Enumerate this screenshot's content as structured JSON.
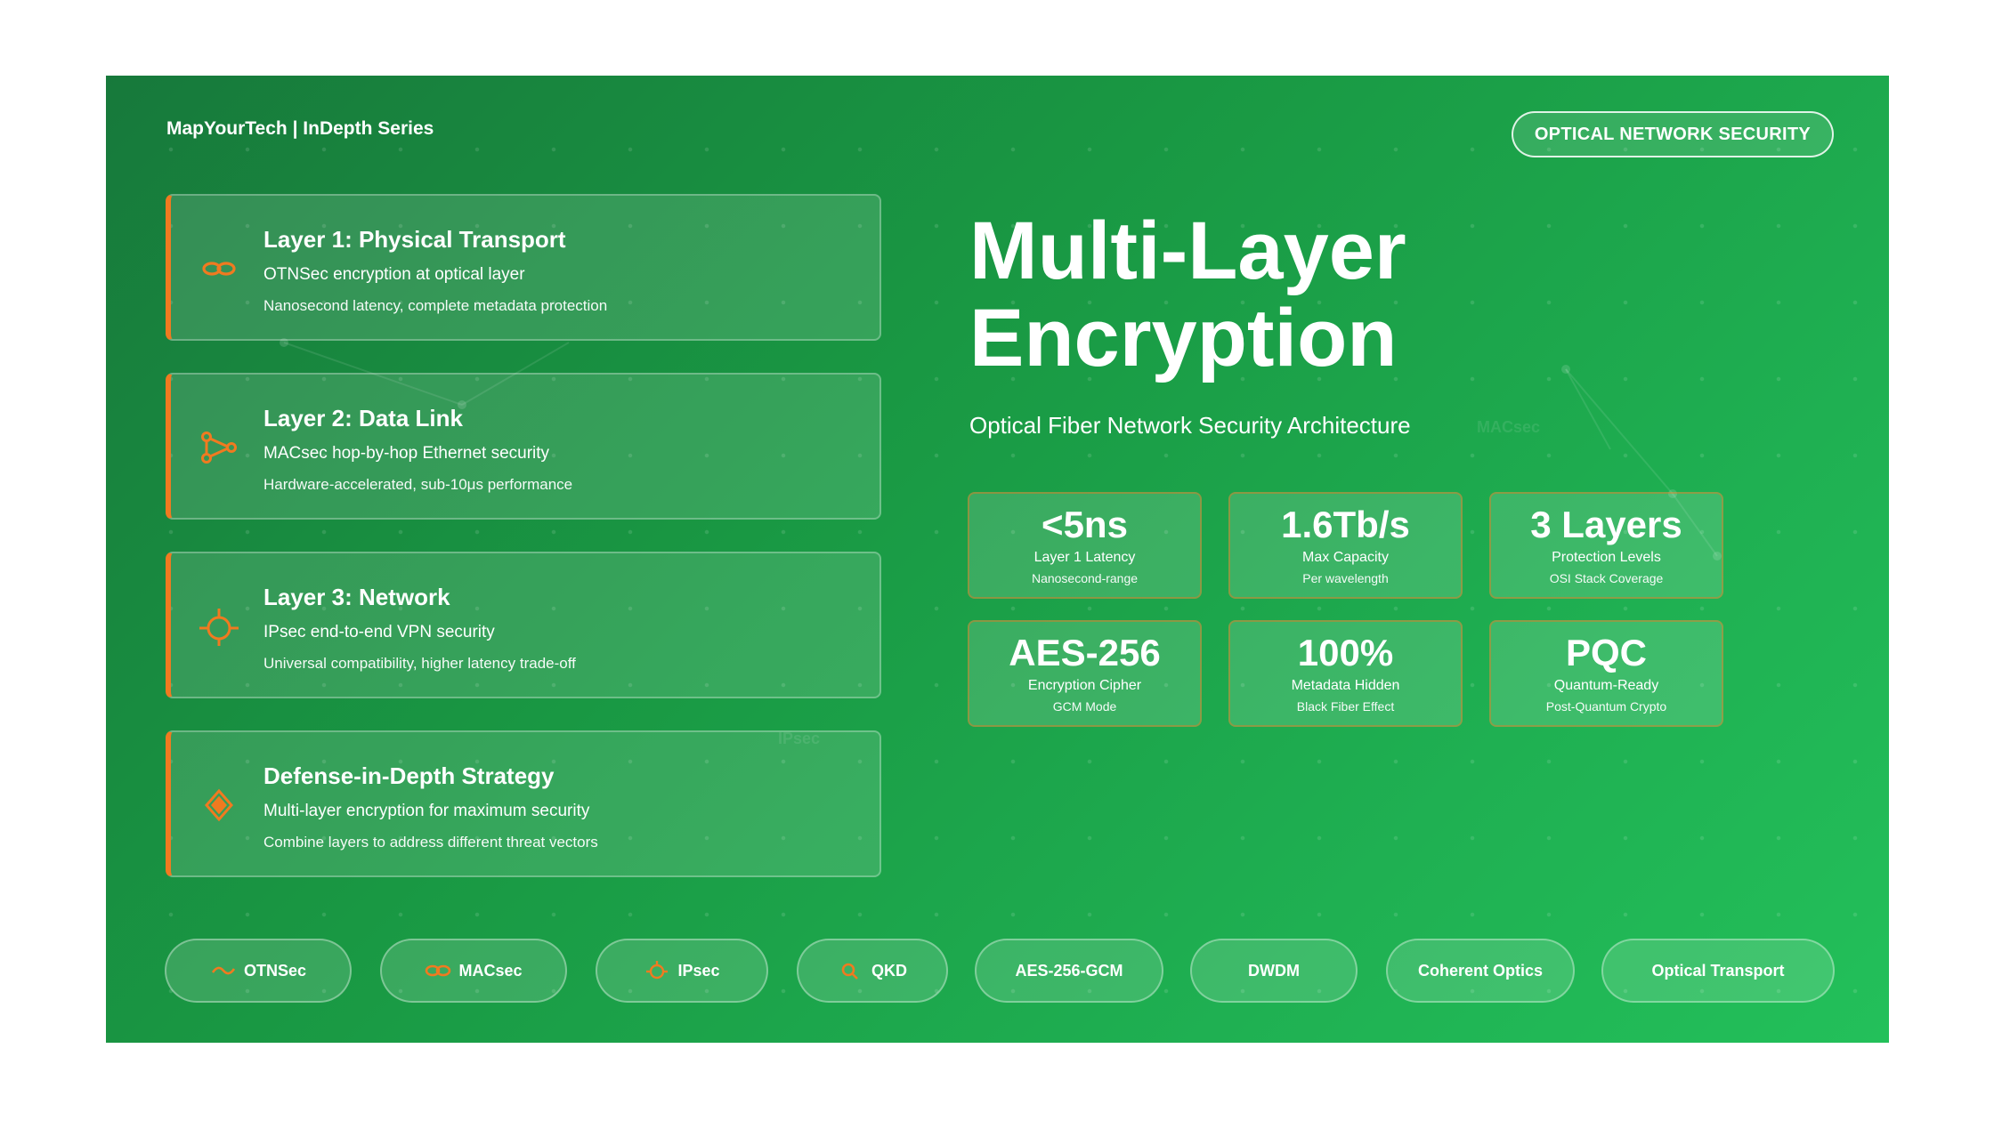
{
  "brand": "MapYourTech | InDepth Series",
  "badge": "OPTICAL NETWORK SECURITY",
  "hero": {
    "title_line1": "Multi-Layer",
    "title_line2": "Encryption",
    "subtitle": "Optical Fiber Network Security Architecture"
  },
  "layers": [
    {
      "title": "Layer 1: Physical Transport",
      "desc": "OTNSec encryption at optical layer",
      "detail": "Nanosecond latency, complete metadata protection",
      "icon": "infinity-link-icon"
    },
    {
      "title": "Layer 2: Data Link",
      "desc": "MACsec hop-by-hop Ethernet security",
      "detail": "Hardware-accelerated, sub-10μs performance",
      "icon": "share-nodes-icon"
    },
    {
      "title": "Layer 3: Network",
      "desc": "IPsec end-to-end VPN security",
      "detail": "Universal compatibility, higher latency trade-off",
      "icon": "crosshair-icon"
    },
    {
      "title": "Defense-in-Depth Strategy",
      "desc": "Multi-layer encryption for maximum security",
      "detail": "Combine layers to address different threat vectors",
      "icon": "diamond-shield-icon"
    }
  ],
  "stats": [
    {
      "value": "<5ns",
      "label": "Layer 1 Latency",
      "sub": "Nanosecond-range"
    },
    {
      "value": "1.6Tb/s",
      "label": "Max Capacity",
      "sub": "Per wavelength"
    },
    {
      "value": "3 Layers",
      "label": "Protection Levels",
      "sub": "OSI Stack Coverage"
    },
    {
      "value": "AES-256",
      "label": "Encryption Cipher",
      "sub": "GCM Mode"
    },
    {
      "value": "100%",
      "label": "Metadata Hidden",
      "sub": "Black Fiber Effect"
    },
    {
      "value": "PQC",
      "label": "Quantum-Ready",
      "sub": "Post-Quantum Crypto"
    }
  ],
  "pills": [
    {
      "label": "OTNSec",
      "icon": "wave-icon"
    },
    {
      "label": "MACsec",
      "icon": "link-icon"
    },
    {
      "label": "IPsec",
      "icon": "target-icon"
    },
    {
      "label": "QKD",
      "icon": "key-icon"
    },
    {
      "label": "AES-256-GCM"
    },
    {
      "label": "DWDM"
    },
    {
      "label": "Coherent Optics"
    },
    {
      "label": "Optical Transport"
    }
  ],
  "ghost": {
    "macsec": "MACsec",
    "ipsec": "IPsec"
  },
  "colors": {
    "accent": "#f07a20",
    "background_start": "#17793b",
    "background_end": "#23c05a",
    "text": "#ffffff"
  }
}
